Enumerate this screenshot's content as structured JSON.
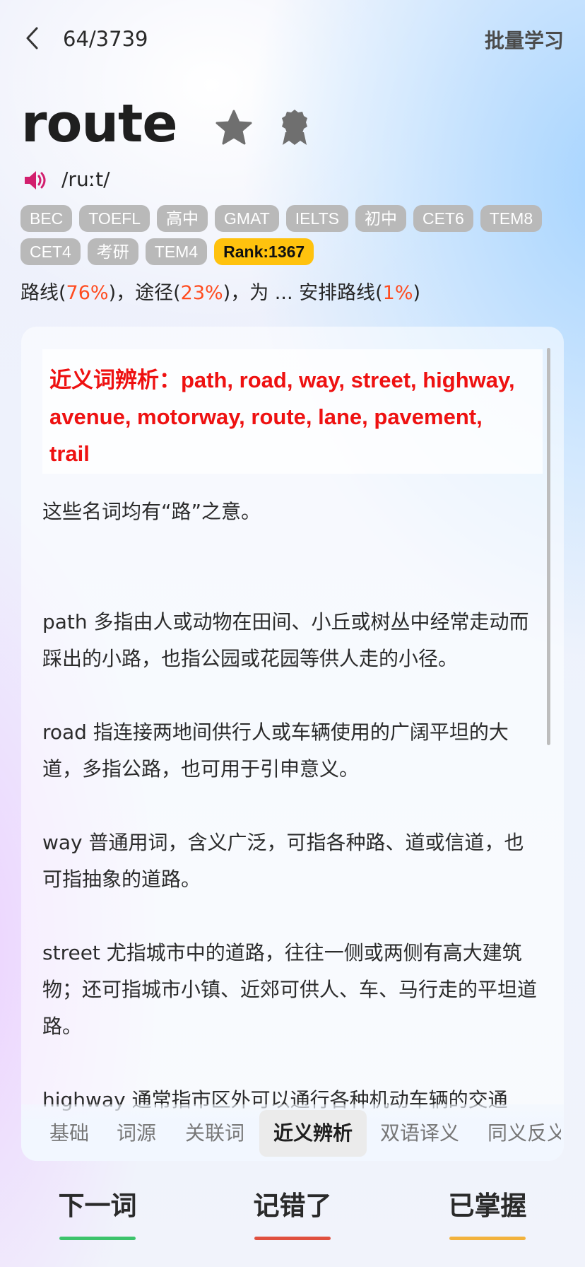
{
  "header": {
    "progress": "64/3739",
    "batch_label": "批量学习"
  },
  "word": {
    "text": "route",
    "phonetic": "/ruːt/",
    "tags": [
      "BEC",
      "TOEFL",
      "高中",
      "GMAT",
      "IELTS",
      "初中",
      "CET6",
      "TEM8",
      "CET4",
      "考研",
      "TEM4"
    ],
    "rank": "Rank:1367",
    "meaning": [
      {
        "text": "路线(",
        "pct": "76%",
        "tail": ")，"
      },
      {
        "text": "途径(",
        "pct": "23%",
        "tail": ")，"
      },
      {
        "text": "为 ... 安排路线(",
        "pct": "1%",
        "tail": ")"
      }
    ]
  },
  "card": {
    "title": "近义词辨析：path, road, way, street, highway, avenue, motorway, route, lane, pavement, trail",
    "paragraphs": [
      "这些名词均有“路”之意。",
      "path 多指由人或动物在田间、小丘或树丛中经常走动而踩出的小路，也指公园或花园等供人走的小径。",
      "road 指连接两地间供行人或车辆使用的广阔平坦的大道，多指公路，也可用于引申意义。",
      "way 普通用词，含义广泛，可指各种路、道或信道，也可指抽象的道路。",
      "street 尤指城市中的道路，往往一侧或两侧有高大建筑物；还可指城市小镇、近郊可供人、车、马行走的平坦道路。",
      "highway 通常指市区外可以通行各种机动车辆的交通"
    ]
  },
  "tabs": [
    "基础",
    "词源",
    "关联词",
    "近义辨析",
    "双语译义",
    "同义反义"
  ],
  "active_tab": "近义辨析",
  "actions": [
    {
      "label": "下一词",
      "color": "#3cc36b"
    },
    {
      "label": "记错了",
      "color": "#e0503f"
    },
    {
      "label": "已掌握",
      "color": "#f2b23c"
    }
  ],
  "colors": {
    "accent_red": "#ee1111",
    "percent": "#ff4b1f",
    "rank_badge": "#ffc20e",
    "tag_bg": "#b9b9b9"
  },
  "icons": {
    "back": "chevron-left-icon",
    "star": "star-icon",
    "badge": "award-badge-icon",
    "speaker": "speaker-icon"
  }
}
